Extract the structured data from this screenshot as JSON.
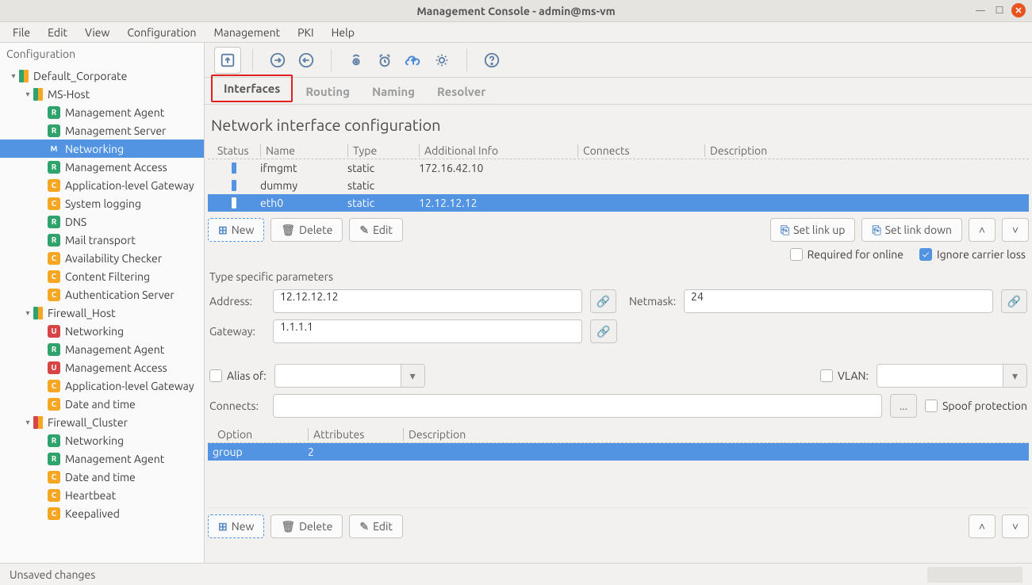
{
  "window": {
    "title": "Management Console - admin@ms-vm"
  },
  "menubar": [
    "File",
    "Edit",
    "View",
    "Configuration",
    "Management",
    "PKI",
    "Help"
  ],
  "sidebar": {
    "header": "Configuration",
    "tree": [
      {
        "level": 1,
        "caret": "▾",
        "multibadge": [
          "g",
          "o"
        ],
        "label": "Default_Corporate"
      },
      {
        "level": 2,
        "caret": "▾",
        "multibadge": [
          "g",
          "o"
        ],
        "label": "MS-Host"
      },
      {
        "level": 3,
        "badge": "R",
        "label": "Management Agent"
      },
      {
        "level": 3,
        "badge": "R",
        "label": "Management Server"
      },
      {
        "level": 3,
        "badge": "M",
        "label": "Networking",
        "selected": true
      },
      {
        "level": 3,
        "badge": "R",
        "label": "Management Access"
      },
      {
        "level": 3,
        "badge": "C",
        "label": "Application-level Gateway"
      },
      {
        "level": 3,
        "badge": "C",
        "label": "System logging"
      },
      {
        "level": 3,
        "badge": "R",
        "label": "DNS"
      },
      {
        "level": 3,
        "badge": "R",
        "label": "Mail transport"
      },
      {
        "level": 3,
        "badge": "C",
        "label": "Availability Checker"
      },
      {
        "level": 3,
        "badge": "C",
        "label": "Content Filtering"
      },
      {
        "level": 3,
        "badge": "C",
        "label": "Authentication Server"
      },
      {
        "level": 2,
        "caret": "▾",
        "multibadge": [
          "g",
          "o"
        ],
        "label": "Firewall_Host"
      },
      {
        "level": 3,
        "badge": "U",
        "label": "Networking"
      },
      {
        "level": 3,
        "badge": "R",
        "label": "Management Agent"
      },
      {
        "level": 3,
        "badge": "U",
        "label": "Management Access"
      },
      {
        "level": 3,
        "badge": "C",
        "label": "Application-level Gateway"
      },
      {
        "level": 3,
        "badge": "C",
        "label": "Date and time"
      },
      {
        "level": 2,
        "caret": "▾",
        "multibadge": [
          "r",
          "o"
        ],
        "label": "Firewall_Cluster"
      },
      {
        "level": 3,
        "badge": "R",
        "label": "Networking"
      },
      {
        "level": 3,
        "badge": "R",
        "label": "Management Agent"
      },
      {
        "level": 3,
        "badge": "C",
        "label": "Date and time"
      },
      {
        "level": 3,
        "badge": "C",
        "label": "Heartbeat"
      },
      {
        "level": 3,
        "badge": "C",
        "label": "Keepalived"
      }
    ]
  },
  "tabs": [
    {
      "label": "Interfaces",
      "active": true,
      "highlight": true
    },
    {
      "label": "Routing"
    },
    {
      "label": "Naming"
    },
    {
      "label": "Resolver"
    }
  ],
  "page": {
    "title": "Network interface configuration"
  },
  "iftable": {
    "headers": [
      "Status",
      "Name",
      "Type",
      "Additional Info",
      "Connects",
      "Description"
    ],
    "rows": [
      {
        "name": "ifmgmt",
        "type": "static",
        "info": "172.16.42.10"
      },
      {
        "name": "dummy",
        "type": "static",
        "info": ""
      },
      {
        "name": "eth0",
        "type": "static",
        "info": "12.12.12.12",
        "selected": true
      }
    ]
  },
  "ifbuttons": {
    "new": "New",
    "delete": "Delete",
    "edit": "Edit",
    "linkup": "Set link up",
    "linkdown": "Set link down"
  },
  "flags": {
    "required": "Required for online",
    "ignore": "Ignore carrier loss",
    "ignore_checked": true
  },
  "params": {
    "section": "Type specific parameters",
    "address_label": "Address:",
    "address": "12.12.12.12",
    "netmask_label": "Netmask:",
    "netmask": "24",
    "gateway_label": "Gateway:",
    "gateway": "1.1.1.1",
    "alias_label": "Alias of:",
    "vlan_label": "VLAN:",
    "connects_label": "Connects:",
    "connects_more": "...",
    "spoof_label": "Spoof protection"
  },
  "opttable": {
    "headers": [
      "Option",
      "Attributes",
      "Description"
    ],
    "rows": [
      {
        "option": "group",
        "attrs": "2",
        "desc": "",
        "selected": true
      }
    ]
  },
  "optbuttons": {
    "new": "New",
    "delete": "Delete",
    "edit": "Edit"
  },
  "status": {
    "text": "Unsaved changes"
  }
}
